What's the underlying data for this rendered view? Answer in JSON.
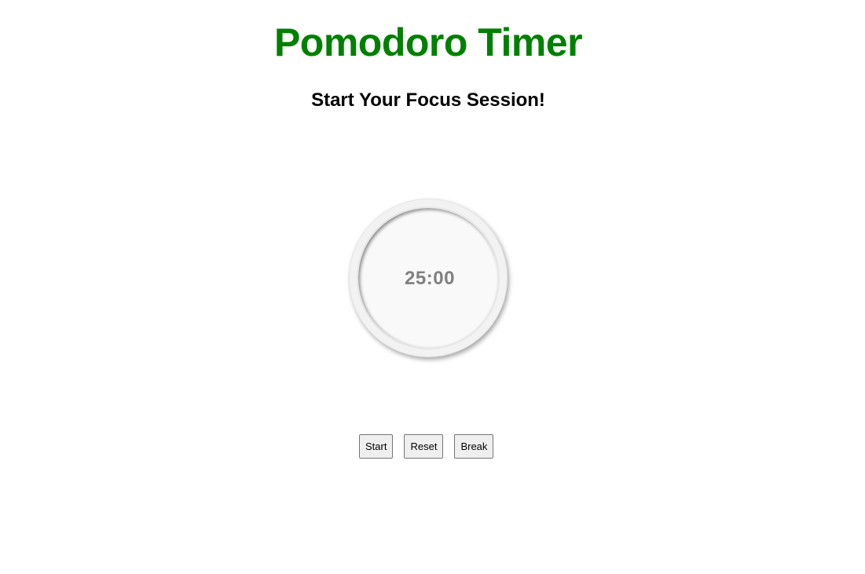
{
  "header": {
    "title": "Pomodoro Timer",
    "subtitle": "Start Your Focus Session!"
  },
  "timer": {
    "display": "25:00"
  },
  "controls": {
    "start_label": "Start",
    "reset_label": "Reset",
    "break_label": "Break"
  },
  "colors": {
    "title": "#008000",
    "timer_text": "#808080",
    "background": "#ffffff"
  }
}
